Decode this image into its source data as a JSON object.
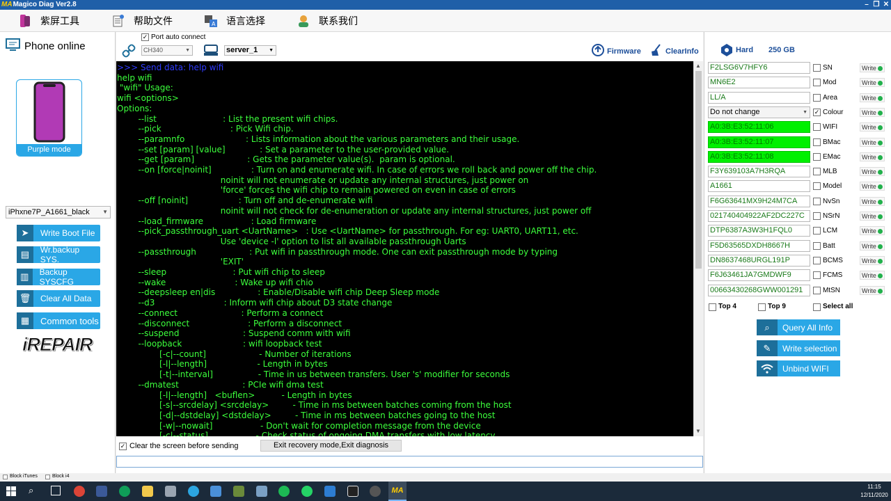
{
  "window": {
    "logo": "MA",
    "title": "Magico Diag Ver2.8"
  },
  "menu": [
    {
      "label": "紫屏工具",
      "icon": "purple-phone-icon",
      "color": "#c0349b"
    },
    {
      "label": "帮助文件",
      "icon": "help-file-icon",
      "color": "#7a7a7a"
    },
    {
      "label": "语言选择",
      "icon": "language-icon",
      "color": "#3a7bd5"
    },
    {
      "label": "联系我们",
      "icon": "contact-icon",
      "color": "#e8a33c"
    }
  ],
  "left": {
    "status": "Phone online",
    "mode_label": "Purple mode",
    "device_select": "iPhxne7P_A1661_black",
    "buttons": [
      "Write Boot File",
      "Wr.backup SYS.",
      "Backup SYSCFG",
      "Clear All Data",
      "Common tools"
    ],
    "brand": "iREPAIR"
  },
  "toolbar": {
    "port_auto_connect": "Port auto connect",
    "port_select": "CH340",
    "server_select": "server_1",
    "firmware": "Firmware",
    "clear_info": "ClearInfo"
  },
  "console_lines": [
    ">>> Send data: help wifi",
    "help wifi",
    " \"wifi\" Usage:",
    "wifi <options>",
    "Options:",
    "        --list                         : List the present wifi chips.",
    "        --pick                          : Pick Wifi chip.",
    "        --paramnfo                       : Lists information about the various parameters and their usage.",
    "        --set [param] [value]             : Set a parameter to the user-provided value.",
    "        --get [param]                    : Gets the parameter value(s).  param is optional.",
    "        --on [force|noinit]               : Turn on and enumerate wifi. In case of errors we roll back and power off the chip.",
    "                                       noinit will not enumerate or update any internal structures, just power on",
    "                                       'force' forces the wifi chip to remain powered on even in case of errors",
    "        --off [noinit]                   : Turn off and de-enumerate wifi",
    "                                       noinit will not check for de-enumeration or update any internal structures, just power off",
    "        --load_firmware                  : Load firmware",
    "        --pick_passthrough_uart <UartName>   : Use <UartName> for passthrough. For eg: UART0, UART11, etc.",
    "                                       Use 'device -l' option to list all available passthrough Uarts",
    "        --passthrough                    : Put wifi in passthrough mode. One can exit passthrough mode by typing",
    "                                       'EXIT'",
    "        --sleep                         : Put wifi chip to sleep",
    "        --wake                          : Wake up wifi chio",
    "        --deepsleep en|dis                : Enable/Disable wifi chip Deep Sleep mode",
    "        --d3                          : Inform wifi chip about D3 state change",
    "        --connect                        : Perform a connect",
    "        --disconnect                      : Perform a disconnect",
    "        --suspend                        : Suspend comm with wifi",
    "        --loopback                       : wifi loopback test",
    "                [-c|--count]                    - Number of iterations",
    "                [-l|--length]                   - Length in bytes",
    "                [-t|--interval]                 - Time in us between transfers. User 's' modifier for seconds",
    "        --dmatest                        : PCIe wifi dma test",
    "                [-l|--length]   <buflen>          - Length in bytes",
    "                [-s|--srcdelay] <srcdelay>         - Time in ms between batches coming from the host",
    "                [-d|--dstdelay] <dstdelay>         - Time in ms between batches going to the host",
    "                [-w|--nowait]                  - Don't wait for completion message from the device",
    "                [-c|--status]                  - Check status of ongoing DMA transfers with low latency"
  ],
  "bottom": {
    "clear_screen": "Clear the screen before sending",
    "exit_button": "Exit recovery mode,Exit diagnosis",
    "block_itunes": "Block iTunes",
    "block_i4": "Block i4"
  },
  "right": {
    "hard_label": "Hard",
    "hard_value": "250 GB",
    "colour_option": "Do not change",
    "write_label": "Write",
    "fields": [
      {
        "value": "F2LSG6V7HFY6",
        "label": "SN",
        "checked": false,
        "green": false
      },
      {
        "value": "MN6E2",
        "label": "Mod",
        "checked": false,
        "green": false
      },
      {
        "value": "LL/A",
        "label": "Area",
        "checked": false,
        "green": false
      },
      {
        "value": "Do not change",
        "label": "Colour",
        "checked": true,
        "green": false,
        "select": true
      },
      {
        "value": "A0:3B:E3:52:11:06",
        "label": "WIFI",
        "checked": false,
        "green": true
      },
      {
        "value": "A0:3B:E3:52:11:07",
        "label": "BMac",
        "checked": false,
        "green": true
      },
      {
        "value": "A0:3B:E3:52:11:08",
        "label": "EMac",
        "checked": false,
        "green": true
      },
      {
        "value": "F3Y639103A7H3RQA",
        "label": "MLB",
        "checked": false,
        "green": false
      },
      {
        "value": "A1661",
        "label": "Model",
        "checked": false,
        "green": false
      },
      {
        "value": "F6G63641MX9H24M7CA",
        "label": "NvSn",
        "checked": false,
        "green": false
      },
      {
        "value": "021740404922AF2DC227C",
        "label": "NSrN",
        "checked": false,
        "green": false
      },
      {
        "value": "DTP6387A3W3H1FQL0",
        "label": "LCM",
        "checked": false,
        "green": false
      },
      {
        "value": "F5D63565DXDH8667H",
        "label": "Batt",
        "checked": false,
        "green": false
      },
      {
        "value": "DN8637468URGL191P",
        "label": "BCMS",
        "checked": false,
        "green": false
      },
      {
        "value": "F6J63461JA7GMDWF9",
        "label": "FCMS",
        "checked": false,
        "green": false
      },
      {
        "value": "00663430268GWW001291",
        "label": "MtSN",
        "checked": false,
        "green": false
      }
    ],
    "top4": "Top 4",
    "top9": "Top 9",
    "select_all": "Select all",
    "actions": [
      {
        "label": "Query All Info",
        "icon": "search-icon"
      },
      {
        "label": "Write selection",
        "icon": "edit-icon"
      },
      {
        "label": "Unbind WIFI",
        "icon": "wifi-icon"
      }
    ]
  },
  "taskbar": {
    "time": "11:15",
    "date": "12/11/2020"
  }
}
